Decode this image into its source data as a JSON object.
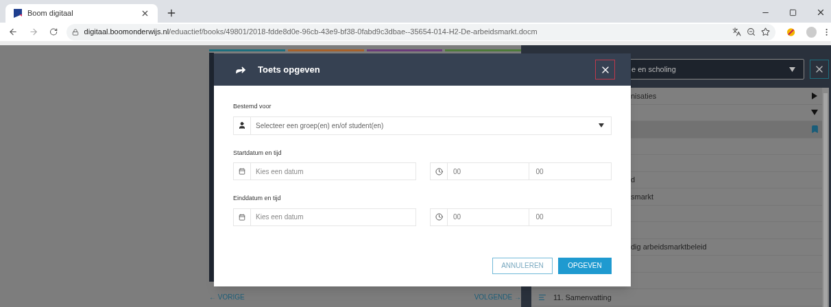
{
  "browser": {
    "tab_title": "Boom digitaal",
    "url_host": "digitaal.boomonderwijs.nl",
    "url_path": "/eduactief/books/49801/2018-fdde8d0e-96cb-43e9-bf38-0fabd9c3dbae--35654-014-H2-De-arbeidsmarkt.docm"
  },
  "page": {
    "prev": "← VORIGE",
    "next": "VOLGENDE →"
  },
  "sidebar": {
    "select_value": "e en scholing",
    "rows": [
      {
        "text": "nisaties",
        "kind": "collapsed",
        "selected": false
      },
      {
        "kind": "expanded",
        "selected": false
      },
      {
        "kind": "bookmarked",
        "selected": true
      },
      {
        "kind": "plain",
        "selected": false
      },
      {
        "kind": "plain",
        "selected": false
      },
      {
        "text": "d",
        "kind": "plain",
        "selected": false
      },
      {
        "text": "smarkt",
        "kind": "plain",
        "selected": false
      },
      {
        "kind": "plain",
        "selected": false
      },
      {
        "kind": "plain",
        "selected": false
      },
      {
        "text": "dig arbeidsmarktbeleid",
        "kind": "plain",
        "selected": false
      },
      {
        "kind": "plain",
        "selected": false
      },
      {
        "kind": "plain",
        "selected": false
      },
      {
        "text": "11. Samenvatting",
        "kind": "section",
        "selected": false
      }
    ]
  },
  "dialog": {
    "title": "Toets opgeven",
    "target": {
      "label": "Bestemd voor",
      "placeholder": "Selecteer een groep(en) en/of student(en)"
    },
    "dates": [
      {
        "label": "Startdatum en tijd",
        "date_placeholder": "Kies een datum",
        "hour": "00",
        "minute": "00"
      },
      {
        "label": "Einddatum en tijd",
        "date_placeholder": "Kies een datum",
        "hour": "00",
        "minute": "00"
      }
    ],
    "cancel": "ANNULEREN",
    "submit": "OPGEVEN"
  }
}
